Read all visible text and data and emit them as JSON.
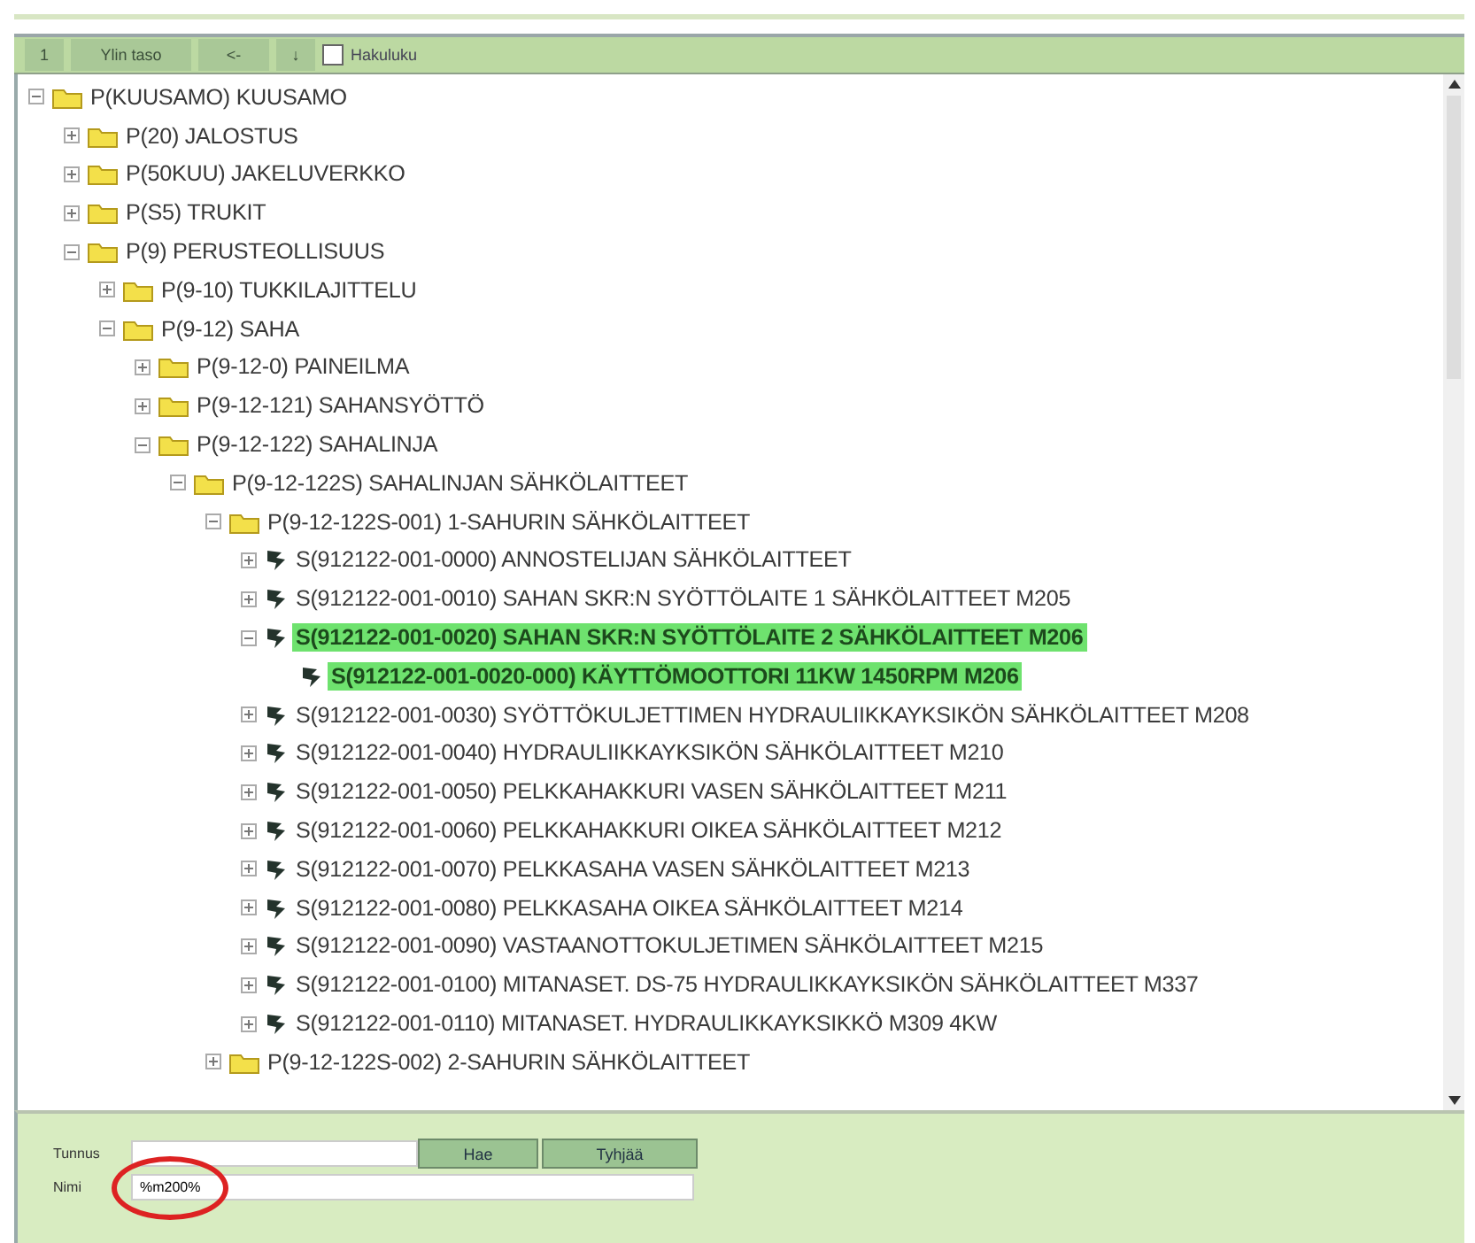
{
  "toolbar": {
    "buttons": [
      "1",
      "Ylin taso",
      "<-",
      "↓"
    ],
    "checkbox": {
      "label": "Hakuluku",
      "checked": false
    }
  },
  "tree": [
    {
      "kind": "folder",
      "label": "P(KUUSAMO) KUUSAMO",
      "expanded": true,
      "selected": false,
      "children": [
        {
          "kind": "folder",
          "label": "P(20) JALOSTUS",
          "expanded": false,
          "selected": false
        },
        {
          "kind": "folder",
          "label": "P(50KUU) JAKELUVERKKO",
          "expanded": false,
          "selected": false
        },
        {
          "kind": "folder",
          "label": "P(S5) TRUKIT",
          "expanded": false,
          "selected": false
        },
        {
          "kind": "folder",
          "label": "P(9) PERUSTEOLLISUUS",
          "expanded": true,
          "selected": false,
          "children": [
            {
              "kind": "folder",
              "label": "P(9-10) TUKKILAJITTELU",
              "expanded": false,
              "selected": false
            },
            {
              "kind": "folder",
              "label": "P(9-12) SAHA",
              "expanded": true,
              "selected": false,
              "children": [
                {
                  "kind": "folder",
                  "label": "P(9-12-0) PAINEILMA",
                  "expanded": false,
                  "selected": false
                },
                {
                  "kind": "folder",
                  "label": "P(9-12-121) SAHANSYÖTTÖ",
                  "expanded": false,
                  "selected": false
                },
                {
                  "kind": "folder",
                  "label": "P(9-12-122) SAHALINJA",
                  "expanded": true,
                  "selected": false,
                  "children": [
                    {
                      "kind": "folder",
                      "label": "P(9-12-122S) SAHALINJAN SÄHKÖLAITTEET",
                      "expanded": true,
                      "selected": false,
                      "children": [
                        {
                          "kind": "folder",
                          "label": "P(9-12-122S-001) 1-SAHURIN SÄHKÖLAITTEET",
                          "expanded": true,
                          "selected": false,
                          "children": [
                            {
                              "kind": "device",
                              "label": "S(912122-001-0000) ANNOSTELIJAN SÄHKÖLAITTEET",
                              "expanded": false,
                              "selected": false
                            },
                            {
                              "kind": "device",
                              "label": "S(912122-001-0010) SAHAN SKR:N SYÖTTÖLAITE 1 SÄHKÖLAITTEET M205",
                              "expanded": false,
                              "selected": false
                            },
                            {
                              "kind": "device",
                              "label": "S(912122-001-0020) SAHAN SKR:N SYÖTTÖLAITE 2 SÄHKÖLAITTEET M206",
                              "expanded": true,
                              "selected": true,
                              "children": [
                                {
                                  "kind": "device",
                                  "label": "S(912122-001-0020-000) KÄYTTÖMOOTTORI 11KW 1450RPM  M206",
                                  "selected": true
                                }
                              ]
                            },
                            {
                              "kind": "device",
                              "label": "S(912122-001-0030) SYÖTTÖKULJETTIMEN HYDRAULIIKKAYKSIKÖN SÄHKÖLAITTEET M208",
                              "expanded": false,
                              "selected": false
                            },
                            {
                              "kind": "device",
                              "label": "S(912122-001-0040) HYDRAULIIKKAYKSIKÖN SÄHKÖLAITTEET M210",
                              "expanded": false,
                              "selected": false
                            },
                            {
                              "kind": "device",
                              "label": "S(912122-001-0050) PELKKAHAKKURI VASEN SÄHKÖLAITTEET M211",
                              "expanded": false,
                              "selected": false
                            },
                            {
                              "kind": "device",
                              "label": "S(912122-001-0060) PELKKAHAKKURI OIKEA SÄHKÖLAITTEET M212",
                              "expanded": false,
                              "selected": false
                            },
                            {
                              "kind": "device",
                              "label": "S(912122-001-0070) PELKKASAHA VASEN SÄHKÖLAITTEET M213",
                              "expanded": false,
                              "selected": false
                            },
                            {
                              "kind": "device",
                              "label": "S(912122-001-0080) PELKKASAHA OIKEA SÄHKÖLAITTEET M214",
                              "expanded": false,
                              "selected": false
                            },
                            {
                              "kind": "device",
                              "label": "S(912122-001-0090) VASTAANOTTOKULJETIMEN SÄHKÖLAITTEET M215",
                              "expanded": false,
                              "selected": false
                            },
                            {
                              "kind": "device",
                              "label": "S(912122-001-0100) MITANASET. DS-75 HYDRAULIKKAYKSIKÖN SÄHKÖLAITTEET M337",
                              "expanded": false,
                              "selected": false
                            },
                            {
                              "kind": "device",
                              "label": "S(912122-001-0110) MITANASET. HYDRAULIKKAYKSIKKÖ M309 4KW",
                              "expanded": false,
                              "selected": false
                            }
                          ]
                        },
                        {
                          "kind": "folder",
                          "label": "P(9-12-122S-002) 2-SAHURIN SÄHKÖLAITTEET",
                          "expanded": false,
                          "selected": false
                        }
                      ]
                    }
                  ]
                }
              ]
            }
          ]
        }
      ]
    }
  ],
  "form": {
    "fields": [
      {
        "label": "Tunnus"
      },
      {
        "label": "Nimi",
        "value": "%m200%"
      }
    ],
    "buttons": [
      "Hae",
      "Tyhjää"
    ]
  }
}
